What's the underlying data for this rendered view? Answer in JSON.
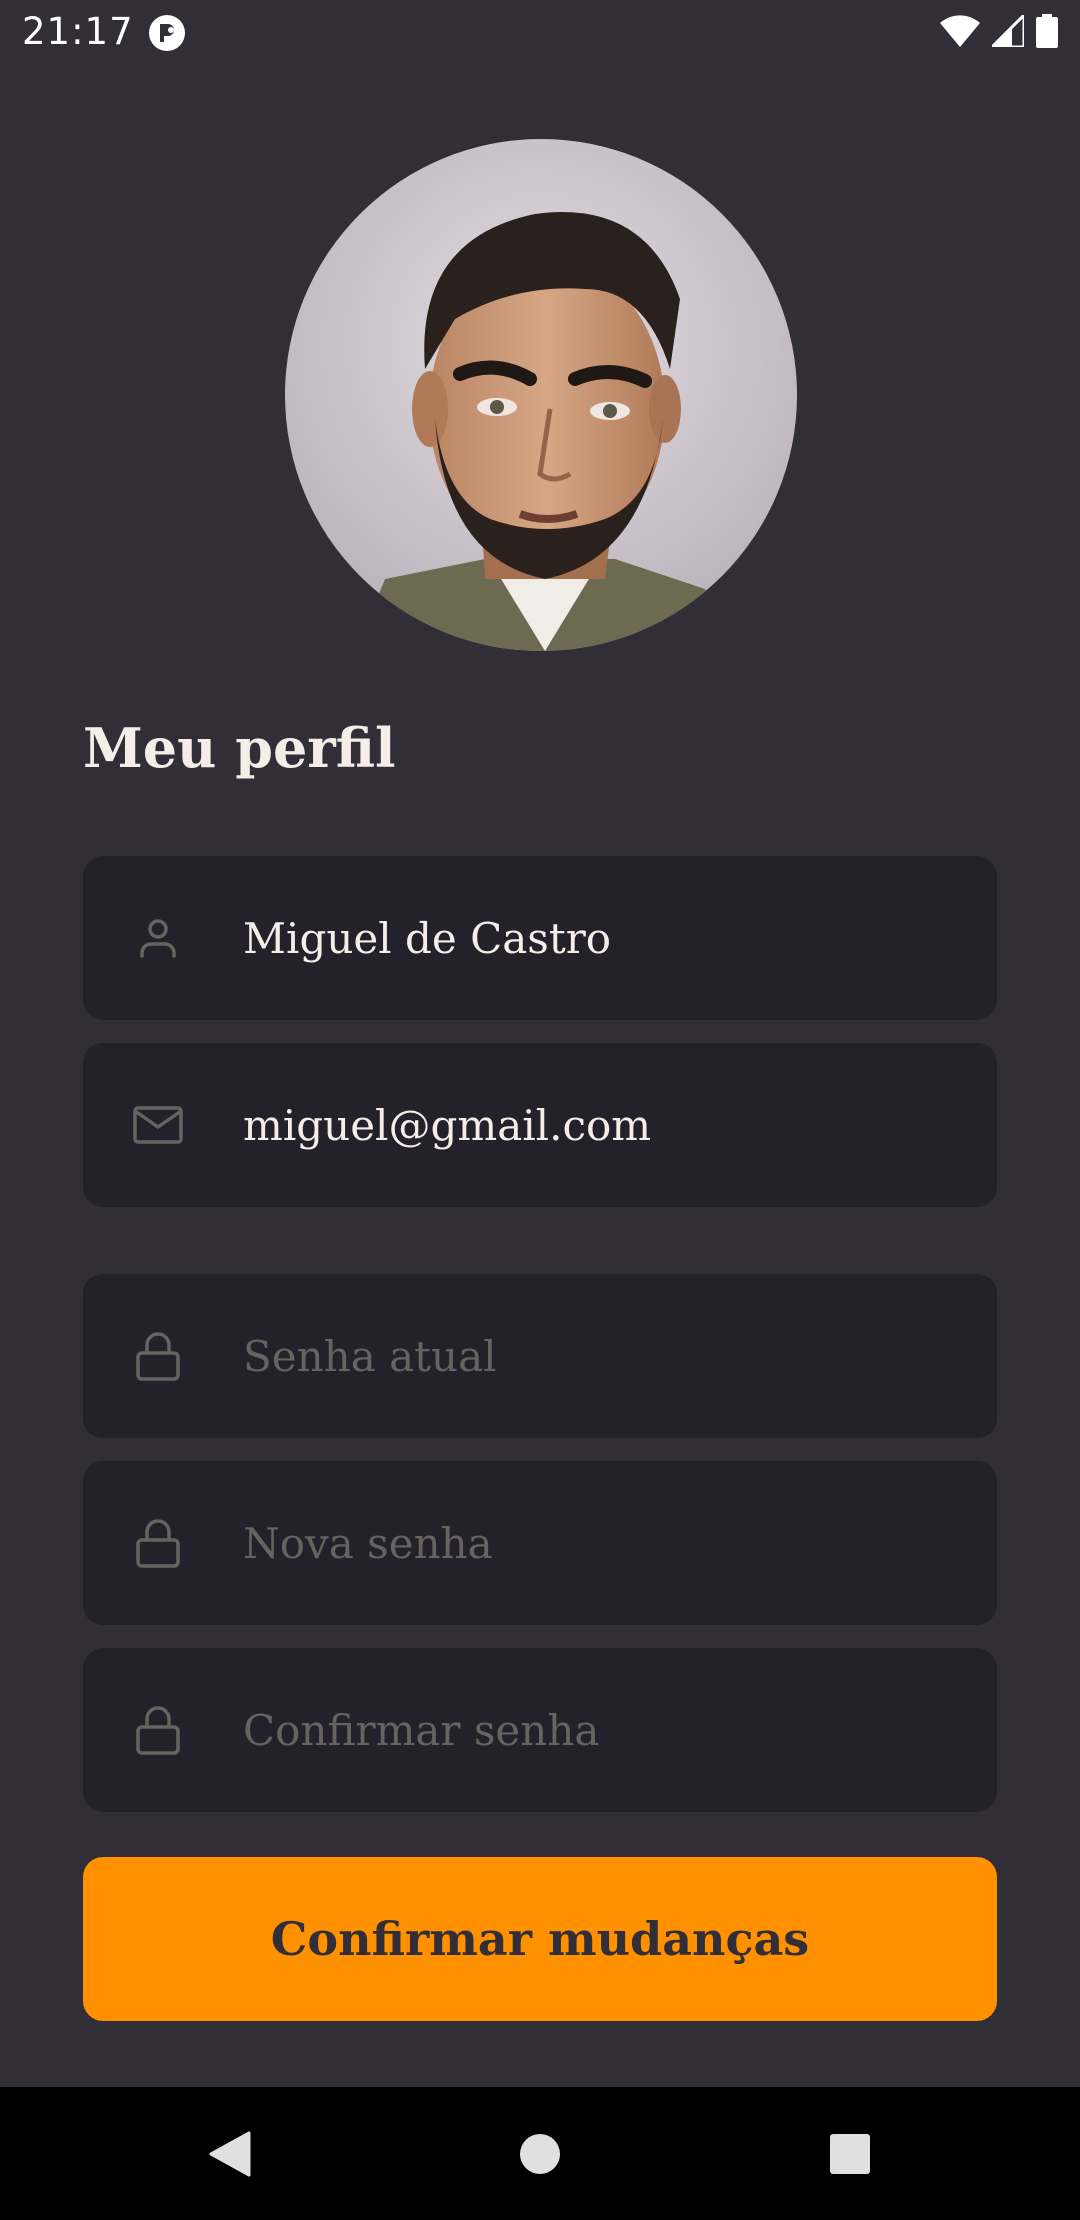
{
  "status_bar": {
    "time": "21:17",
    "icons": [
      "app-notification-icon",
      "wifi-icon",
      "cellular-signal-icon",
      "battery-icon"
    ]
  },
  "profile": {
    "avatar": "avatar-photo"
  },
  "title": "Meu perfil",
  "form": {
    "name": {
      "value": "Miguel de Castro",
      "icon": "user-icon"
    },
    "email": {
      "value": "miguel@gmail.com",
      "icon": "mail-icon"
    },
    "current_password": {
      "placeholder": "Senha atual",
      "icon": "lock-icon"
    },
    "new_password": {
      "placeholder": "Nova senha",
      "icon": "lock-icon"
    },
    "confirm_password": {
      "placeholder": "Confirmar senha",
      "icon": "lock-icon"
    }
  },
  "submit_label": "Confirmar mudanças",
  "nav": {
    "icons": [
      "back-icon",
      "home-icon",
      "recents-icon"
    ]
  },
  "colors": {
    "background": "#312e38",
    "input_background": "#232129",
    "accent": "#ff9000",
    "text": "#f4ede8",
    "placeholder": "#666360",
    "icon": "#666360"
  }
}
